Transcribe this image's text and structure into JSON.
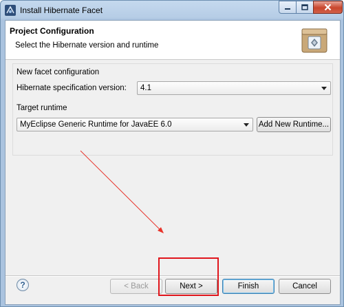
{
  "window": {
    "title": "Install Hibernate Facet"
  },
  "banner": {
    "title": "Project Configuration",
    "subtitle": "Select the Hibernate version and runtime"
  },
  "facet_config": {
    "group_label": "New facet configuration",
    "spec_label": "Hibernate specification version:",
    "spec_value": "4.1"
  },
  "runtime": {
    "group_label": "Target runtime",
    "runtime_value": "MyEclipse Generic Runtime for JavaEE 6.0",
    "add_button": "Add New Runtime..."
  },
  "footer": {
    "help_glyph": "?",
    "back": "< Back",
    "next": "Next >",
    "finish": "Finish",
    "cancel": "Cancel"
  },
  "annotation": {
    "arrow_color": "#e8332a",
    "box_color": "#e0151b"
  }
}
